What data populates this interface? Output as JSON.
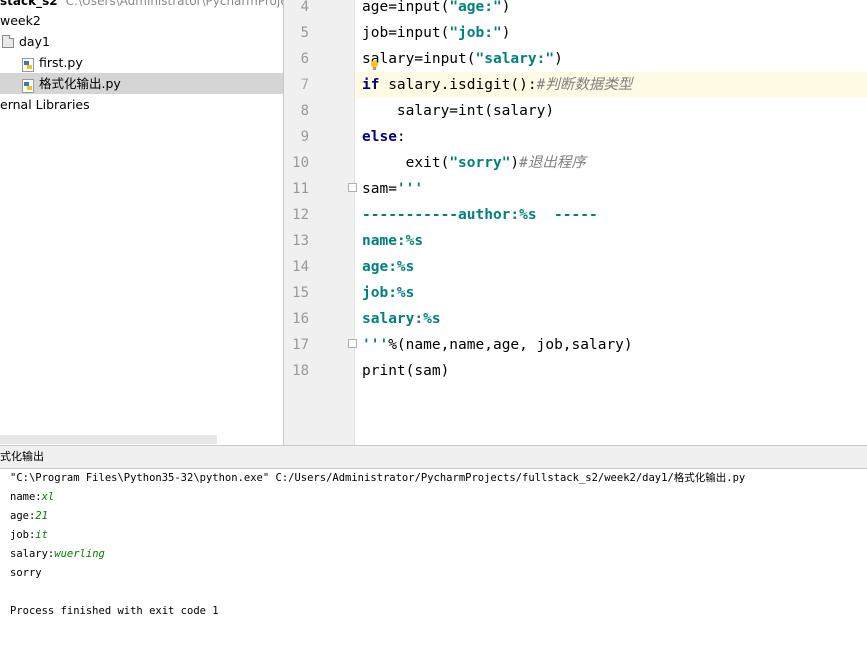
{
  "project": {
    "root_name": "stack_s2",
    "root_path": "C:\\Users\\Administrator\\PycharmProjects",
    "items": [
      {
        "label": "week2"
      },
      {
        "label": "day1"
      },
      {
        "label": "first.py"
      },
      {
        "label": "格式化输出.py"
      },
      {
        "label": "ernal Libraries"
      }
    ]
  },
  "editor": {
    "line_numbers": [
      "4",
      "5",
      "6",
      "7",
      "8",
      "9",
      "10",
      "11",
      "12",
      "13",
      "14",
      "15",
      "16",
      "17",
      "18"
    ],
    "current_line": "7",
    "lines": {
      "l4": {
        "a": "age=input(",
        "b": "\"age:\"",
        "c": ")"
      },
      "l5": {
        "a": "job=input(",
        "b": "\"job:\"",
        "c": ")"
      },
      "l6": {
        "a": "salary=input(",
        "b": "\"salary:\"",
        "c": ")"
      },
      "l7": {
        "kw": "if",
        "a": " salary.isdigit():",
        "cmt": "#判断数据类型"
      },
      "l8": {
        "a": "    salary=int(salary)"
      },
      "l9": {
        "kw": "else",
        "a": ":"
      },
      "l10": {
        "a": "     exit(",
        "b": "\"sorry\"",
        "c": ")",
        "cmt": "#退出程序"
      },
      "l11": {
        "a": "sam=",
        "b": "'''"
      },
      "l12": {
        "b": "-----------author:%s  -----"
      },
      "l13": {
        "b": "name:%s"
      },
      "l14": {
        "b": "age:%s"
      },
      "l15": {
        "b": "job:%s"
      },
      "l16": {
        "b": "salary:%s"
      },
      "l17": {
        "b": "'''",
        "a": "%(name,name,age, job,salary)"
      },
      "l18": {
        "a": "print(sam)"
      }
    }
  },
  "run": {
    "tab_label": "式化输出",
    "command": "\"C:\\Program Files\\Python35-32\\python.exe\" C:/Users/Administrator/PycharmProjects/fullstack_s2/week2/day1/格式化输出.py",
    "prompts": [
      {
        "prompt": "name:",
        "input": "xl"
      },
      {
        "prompt": "age:",
        "input": "21"
      },
      {
        "prompt": "job:",
        "input": "it"
      },
      {
        "prompt": "salary:",
        "input": "wuerling"
      }
    ],
    "output": "sorry",
    "exit_message": "Process finished with exit code 1"
  },
  "colors": {
    "keyword": "#000080",
    "string": "#008080",
    "comment": "#808080",
    "user_input": "#008000",
    "current_line_bg": "#fffae3",
    "selection_bg": "#d5d5d5"
  }
}
